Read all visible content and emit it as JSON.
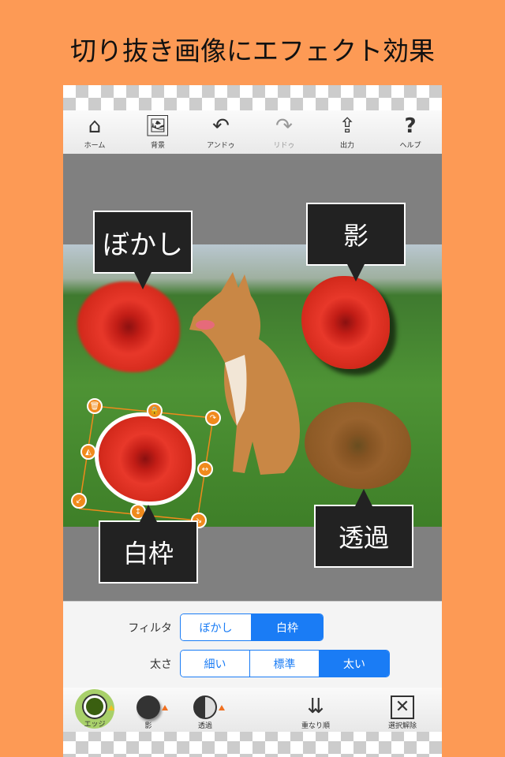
{
  "headline": "切り抜き画像にエフェクト効果",
  "toolbar": {
    "items": [
      {
        "label": "ホーム",
        "icon": "home-icon"
      },
      {
        "label": "背景",
        "icon": "image-icon"
      },
      {
        "label": "アンドゥ",
        "icon": "undo-icon"
      },
      {
        "label": "リドゥ",
        "icon": "redo-icon",
        "disabled": true
      },
      {
        "label": "出力",
        "icon": "share-icon"
      },
      {
        "label": "ヘルプ",
        "icon": "help-icon"
      }
    ]
  },
  "callouts": {
    "blur": "ぼかし",
    "shadow": "影",
    "white_border": "白枠",
    "transparency": "透過"
  },
  "panel": {
    "filter_label": "フィルタ",
    "filter_options": [
      "ぼかし",
      "白枠"
    ],
    "filter_selected": "白枠",
    "width_label": "太さ",
    "width_options": [
      "細い",
      "標準",
      "太い"
    ],
    "width_selected": "太い"
  },
  "bottombar": {
    "edge": "エッジ",
    "shadow": "影",
    "transparency": "透過",
    "order": "重なり順",
    "deselect": "選択解除"
  },
  "colors": {
    "background": "#fd9a55",
    "accent": "#1a7cf5",
    "handle": "#f08a1c",
    "edge_active": "#a8d06a"
  }
}
